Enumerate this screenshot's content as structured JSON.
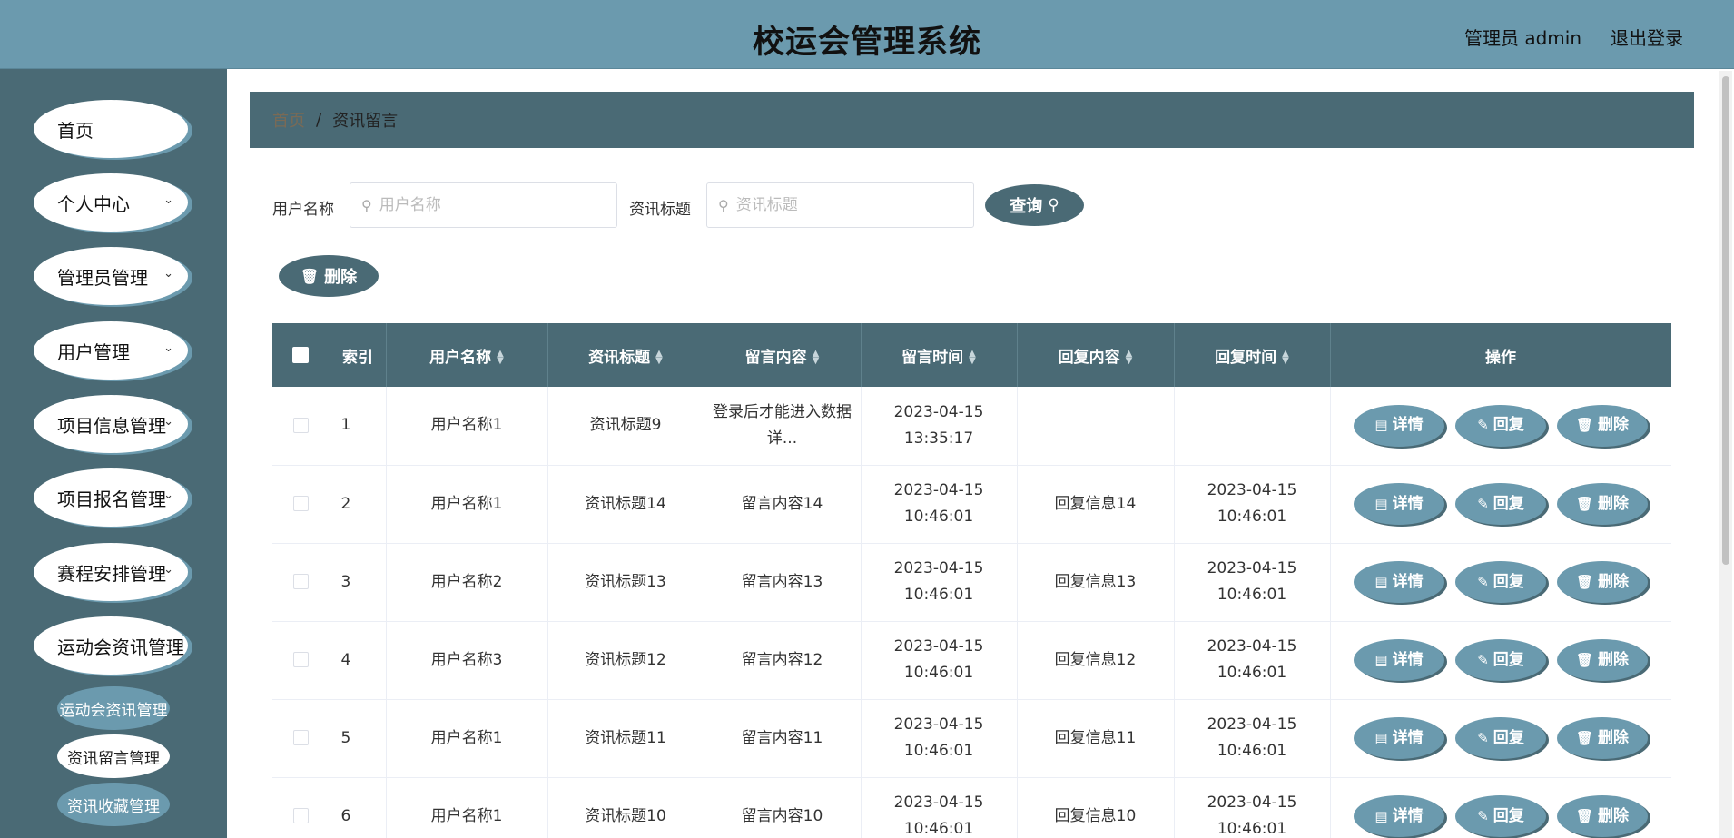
{
  "header": {
    "title": "校运会管理系统",
    "user": "管理员 admin",
    "logout": "退出登录"
  },
  "sidebar": {
    "items": [
      {
        "label": "首页",
        "has_arrow": false
      },
      {
        "label": "个人中心",
        "has_arrow": true
      },
      {
        "label": "管理员管理",
        "has_arrow": true
      },
      {
        "label": "用户管理",
        "has_arrow": true
      },
      {
        "label": "项目信息管理",
        "has_arrow": true
      },
      {
        "label": "项目报名管理",
        "has_arrow": true
      },
      {
        "label": "赛程安排管理",
        "has_arrow": true
      },
      {
        "label": "运动会资讯管理",
        "has_arrow": true
      }
    ],
    "sub_items": [
      {
        "label": "运动会资讯管理",
        "active": false
      },
      {
        "label": "资讯留言管理",
        "active": true
      },
      {
        "label": "资讯收藏管理",
        "active": false
      }
    ]
  },
  "breadcrumb": {
    "home": "首页",
    "separator": "/",
    "current": "资讯留言"
  },
  "search": {
    "username_label": "用户名称",
    "username_placeholder": "用户名称",
    "username_value": "",
    "title_label": "资讯标题",
    "title_placeholder": "资讯标题",
    "title_value": "",
    "query_button": "查询"
  },
  "toolbar": {
    "delete_button": "删除"
  },
  "table": {
    "headers": [
      "索引",
      "用户名称",
      "资讯标题",
      "留言内容",
      "留言时间",
      "回复内容",
      "回复时间",
      "操作"
    ],
    "rows": [
      {
        "index": "1",
        "username": "用户名称1",
        "title": "资讯标题9",
        "content": "登录后才能进入数据详...",
        "time": "2023-04-15 13:35:17",
        "reply": "",
        "reply_time": ""
      },
      {
        "index": "2",
        "username": "用户名称1",
        "title": "资讯标题14",
        "content": "留言内容14",
        "time": "2023-04-15 10:46:01",
        "reply": "回复信息14",
        "reply_time": "2023-04-15 10:46:01"
      },
      {
        "index": "3",
        "username": "用户名称2",
        "title": "资讯标题13",
        "content": "留言内容13",
        "time": "2023-04-15 10:46:01",
        "reply": "回复信息13",
        "reply_time": "2023-04-15 10:46:01"
      },
      {
        "index": "4",
        "username": "用户名称3",
        "title": "资讯标题12",
        "content": "留言内容12",
        "time": "2023-04-15 10:46:01",
        "reply": "回复信息12",
        "reply_time": "2023-04-15 10:46:01"
      },
      {
        "index": "5",
        "username": "用户名称1",
        "title": "资讯标题11",
        "content": "留言内容11",
        "time": "2023-04-15 10:46:01",
        "reply": "回复信息11",
        "reply_time": "2023-04-15 10:46:01"
      },
      {
        "index": "6",
        "username": "用户名称1",
        "title": "资讯标题10",
        "content": "留言内容10",
        "time": "2023-04-15 10:46:01",
        "reply": "回复信息10",
        "reply_time": "2023-04-15 10:46:01"
      }
    ],
    "actions": {
      "detail": "详情",
      "reply": "回复",
      "delete": "删除"
    }
  },
  "icons": {
    "search": "search-icon",
    "delete": "trash-icon",
    "detail": "document-icon",
    "reply": "pencil-icon",
    "sort": "sort-icon",
    "chevron": "chevron-down-icon"
  },
  "colors": {
    "header": "#6b9aae",
    "sidebar": "#4a6a75",
    "button": "#4a6a75",
    "action_button": "#6b9aae"
  }
}
